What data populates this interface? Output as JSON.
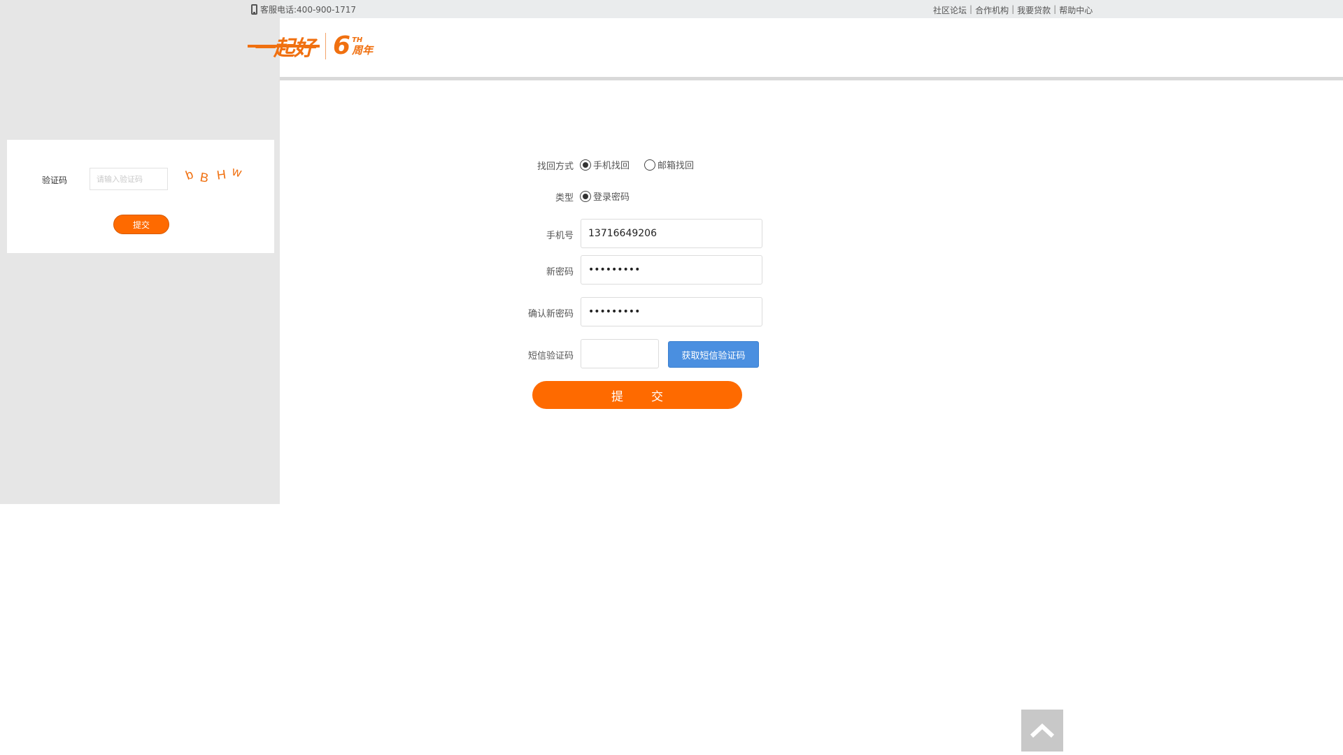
{
  "topbar": {
    "phone": "客服电话:400-900-1717",
    "links": [
      "社区论坛",
      "合作机构",
      "我要贷款",
      "帮助中心"
    ],
    "separator": "|"
  },
  "logo": {
    "main": "一起好",
    "six": "6",
    "th": "TH",
    "anniversary": "周年"
  },
  "popup": {
    "label": "验证码",
    "placeholder": "请输入验证码",
    "captcha_chars": [
      "b",
      "B",
      "H",
      "w"
    ],
    "submit": "提交"
  },
  "form": {
    "method_label": "找回方式",
    "method_options": [
      "手机找回",
      "邮箱找回"
    ],
    "method_selected": "手机找回",
    "type_label": "类型",
    "type_options": [
      "登录密码"
    ],
    "type_selected": "登录密码",
    "phone_label": "手机号",
    "phone_value": "13716649206",
    "new_pwd_label": "新密码",
    "new_pwd_value": "•••••••••",
    "confirm_pwd_label": "确认新密码",
    "confirm_pwd_value": "•••••••••",
    "sms_label": "短信验证码",
    "sms_value": "",
    "sms_button": "获取短信验证码",
    "submit_chars": [
      "提",
      "交"
    ]
  },
  "colors": {
    "accent": "#fe6a00",
    "blue": "#4a8fe0",
    "overlay": "#e6e6e6"
  },
  "icons": {
    "phone": "phone-icon",
    "to_top": "chevron-up-icon"
  }
}
